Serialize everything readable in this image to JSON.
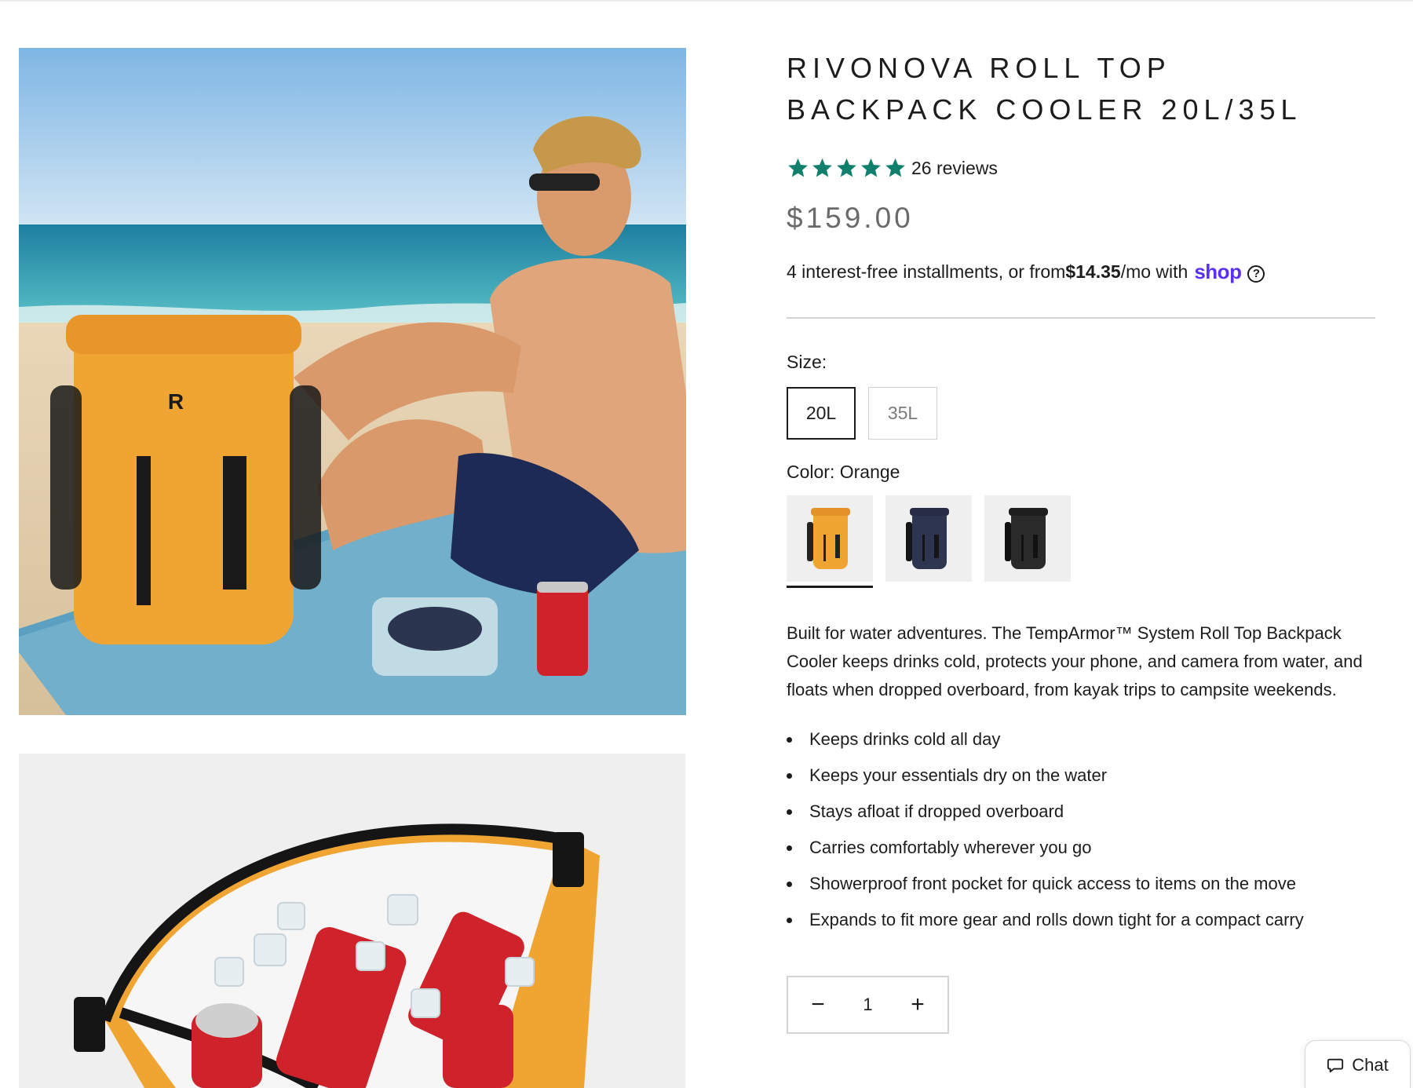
{
  "product": {
    "title": "RIVONOVA ROLL TOP BACKPACK COOLER 20L/35L",
    "rating": 5,
    "review_count": "26 reviews",
    "price": "$159.00",
    "installments": {
      "prefix": "4 interest-free installments, or from ",
      "amount": "$14.35",
      "suffix": "/mo with",
      "provider": "shop",
      "help": "?"
    },
    "size": {
      "label": "Size:",
      "options": [
        "20L",
        "35L"
      ],
      "selected": "20L"
    },
    "color": {
      "label": "Color: Orange",
      "options": [
        "Orange",
        "Navy",
        "Black"
      ],
      "selected": "Orange"
    },
    "description": "Built for water adventures. The TempArmor™ System Roll Top Backpack Cooler keeps drinks cold, protects your phone, and camera from water, and floats when dropped overboard, from kayak trips to campsite weekends.",
    "features": [
      "Keeps drinks cold all day",
      "Keeps your essentials dry on the water",
      "Stays afloat if dropped overboard",
      "Carries comfortably wherever you go",
      "Showerproof front pocket for quick access to items on the move",
      "Expands to fit more gear and rolls down tight for a compact carry"
    ],
    "quantity": "1",
    "qty_minus": "−",
    "qty_plus": "+"
  },
  "chat": {
    "label": "Chat"
  },
  "colors": {
    "star": "#10806c",
    "shop_brand": "#5a31f4",
    "orange": "#f0a532",
    "navy": "#2e3550",
    "black": "#2a2a2a"
  },
  "icons": [
    "star-icon",
    "question-circle-icon",
    "minus-icon",
    "plus-icon",
    "chat-bubble-icon"
  ]
}
